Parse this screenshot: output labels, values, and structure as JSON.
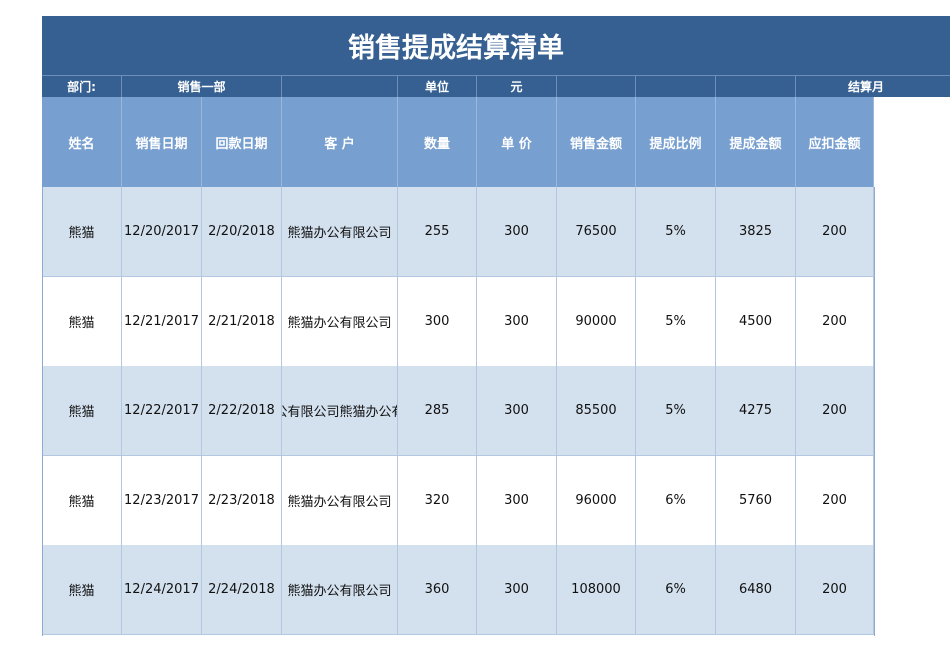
{
  "title": "销售提成结算清单",
  "info": {
    "dept_label": "部门:",
    "dept_value": "销售一部",
    "unit_label": "单位",
    "unit_value": "元",
    "settle_label": "结算月"
  },
  "headers": [
    "姓名",
    "销售日期",
    "回款日期",
    "客  户",
    "数量",
    "单 价",
    "销售金额",
    "提成比例",
    "提成金额",
    "应扣金额"
  ],
  "rows": [
    [
      "熊猫",
      "12/20/2017",
      "2/20/2018",
      "熊猫办公有限公司",
      "255",
      "300",
      "76500",
      "5%",
      "3825",
      "200"
    ],
    [
      "熊猫",
      "12/21/2017",
      "2/21/2018",
      "熊猫办公有限公司",
      "300",
      "300",
      "90000",
      "5%",
      "4500",
      "200"
    ],
    [
      "熊猫",
      "12/22/2017",
      "2/22/2018",
      "熊猫办公有限公司熊猫办公有限公司",
      "285",
      "300",
      "85500",
      "5%",
      "4275",
      "200"
    ],
    [
      "熊猫",
      "12/23/2017",
      "2/23/2018",
      "熊猫办公有限公司",
      "320",
      "300",
      "96000",
      "6%",
      "5760",
      "200"
    ],
    [
      "熊猫",
      "12/24/2017",
      "2/24/2018",
      "熊猫办公有限公司",
      "360",
      "300",
      "108000",
      "6%",
      "6480",
      "200"
    ]
  ]
}
